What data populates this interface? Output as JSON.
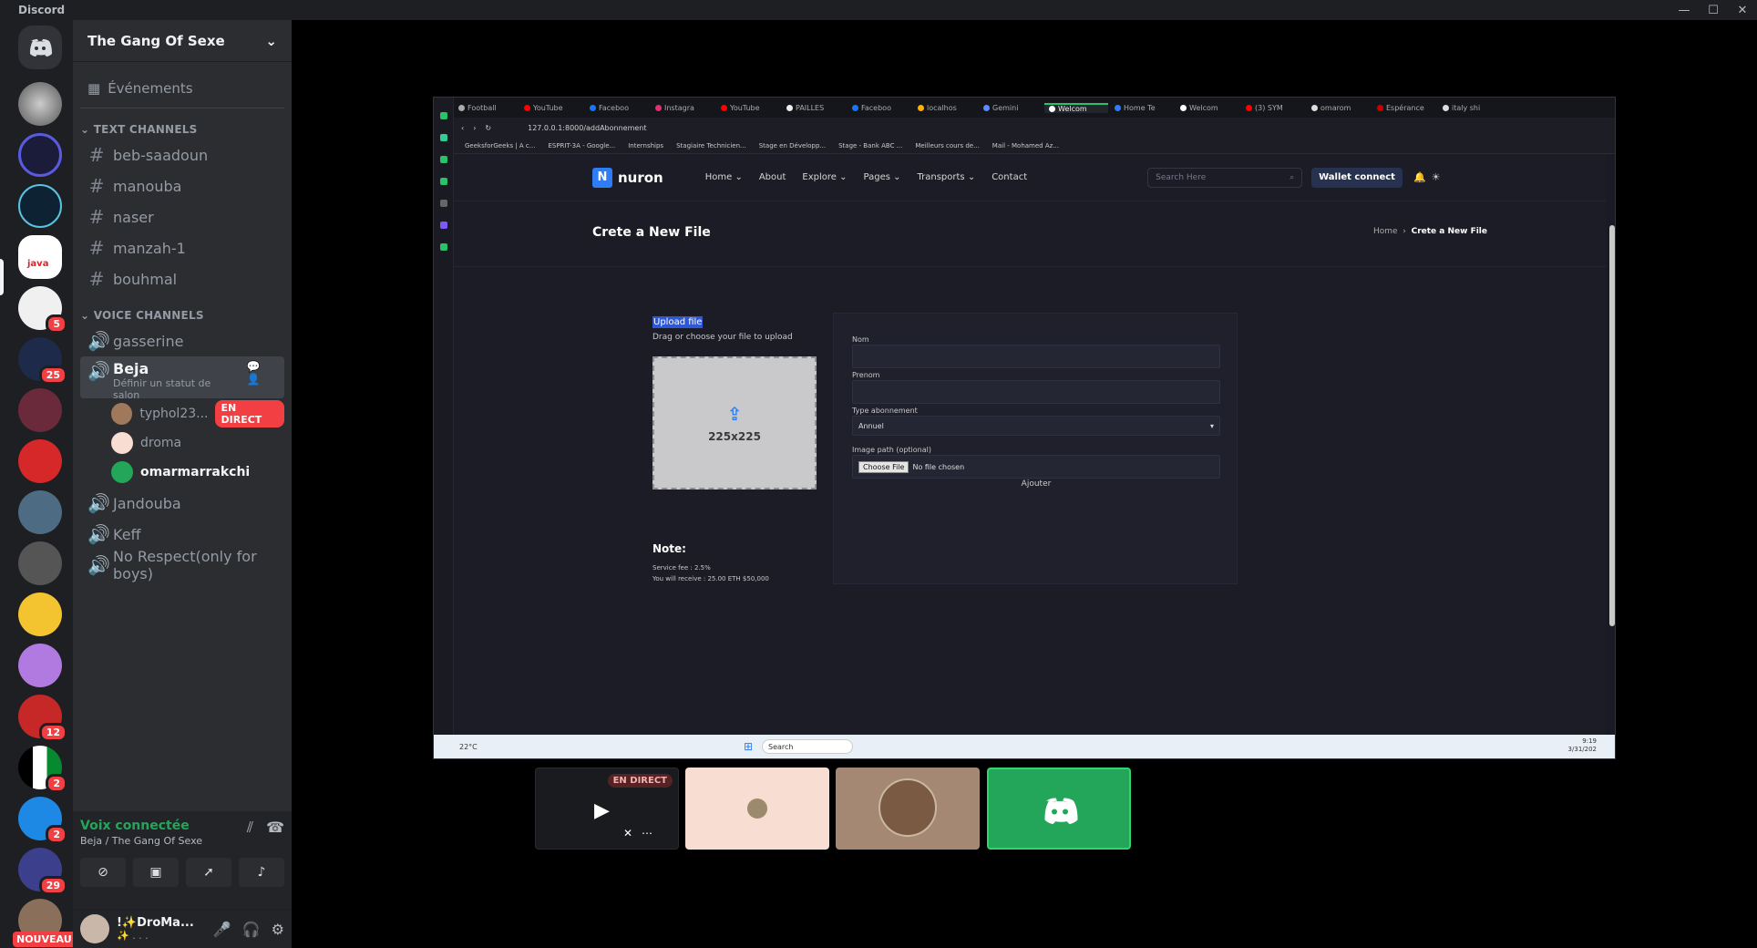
{
  "app_title": "Discord",
  "window_controls": [
    "—",
    "☐",
    "✕"
  ],
  "server_rail": {
    "badges": [
      "5",
      "25",
      "12",
      "2",
      "2",
      "29"
    ],
    "nouveau": "NOUVEAU"
  },
  "guild": {
    "name": "The Gang Of Sexe",
    "events": "Événements"
  },
  "text_category": "TEXT CHANNELS",
  "text_channels": [
    "beb-saadoun",
    "manouba",
    "naser",
    "manzah-1",
    "bouhmal"
  ],
  "voice_category": "VOICE CHANNELS",
  "voice_channels": {
    "first": "gasserine",
    "active": {
      "name": "Beja",
      "status": "Définir un statut de salon"
    },
    "members": [
      {
        "name": "typhol23...",
        "live": "EN DIRECT"
      },
      {
        "name": "droma"
      },
      {
        "name": "omarmarrakchi"
      }
    ],
    "rest": [
      "Jandouba",
      "Keff",
      "No Respect(only for boys)"
    ]
  },
  "voice_panel": {
    "connected": "Voix connectée",
    "location": "Beja / The Gang Of Sexe"
  },
  "user": {
    "name": "!✨DroMa...",
    "sub": "✨ . . ."
  },
  "browser": {
    "tabs": [
      "Football",
      "YouTube",
      "Faceboo",
      "Instagra",
      "YouTube",
      "PAILLES",
      "Faceboo",
      "localhos",
      "Gemini",
      "Welcom",
      "Home Te",
      "Welcom",
      "(3) SYM",
      "omarom",
      "Espérance",
      "italy shi"
    ],
    "url": "127.0.0.1:8000/addAbonnement",
    "bookmarks": [
      "GeeksforGeeks | A c...",
      "ESPRIT-3A - Google...",
      "Internships",
      "Stagiaire Technicien...",
      "Stage en Développ...",
      "Stage - Bank ABC ...",
      "Meilleurs cours de...",
      "Mail - Mohamed Az..."
    ]
  },
  "site": {
    "brand": "nuron",
    "menu": [
      "Home ⌄",
      "About",
      "Explore ⌄",
      "Pages ⌄",
      "Transports ⌄",
      "Contact"
    ],
    "search_placeholder": "Search Here",
    "wallet": "Wallet connect",
    "page_title": "Crete a New File",
    "crumb_home": "Home",
    "crumb_current": "Crete a New File",
    "upload_label": "Upload file",
    "upload_sub": "Drag or choose your file to upload",
    "placeholder_size": "225x225",
    "fields": {
      "nom": "Nom",
      "prenom": "Prenom",
      "type": "Type abonnement",
      "type_value": "Annuel",
      "image": "Image path (optional)",
      "choose": "Choose File",
      "no_file": "No file chosen"
    },
    "submit": "Ajouter",
    "note_title": "Note:",
    "service_fee": "Service fee : 2.5%",
    "receive": "You will receive : 25.00 ETH $50,000"
  },
  "taskbar": {
    "weather": "22°C",
    "search": "Search",
    "time": "9:19",
    "date": "3/31/202"
  },
  "stream_tiles": {
    "live": "EN DIRECT"
  }
}
